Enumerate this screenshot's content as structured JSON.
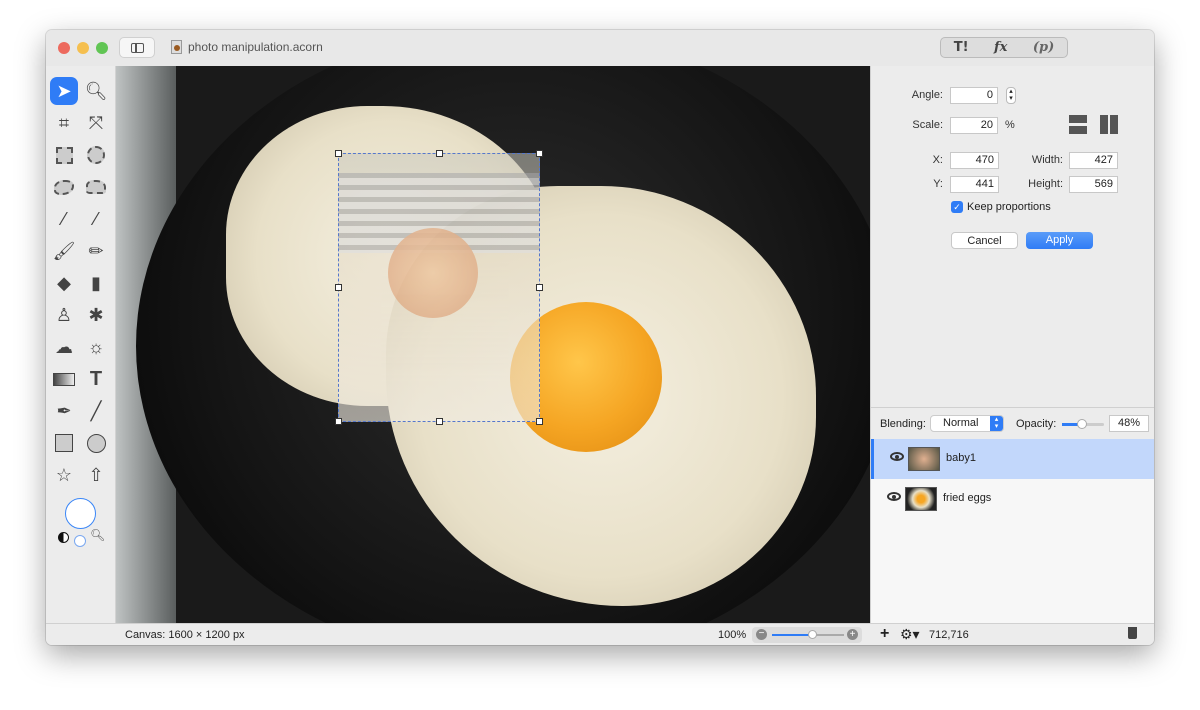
{
  "window": {
    "title": "photo manipulation.acorn",
    "traffic_lights": {
      "close": "#ed6a5e",
      "minimize": "#f5bf4f",
      "zoom": "#61c554"
    }
  },
  "toolbar_segments": [
    {
      "icon": "tools-icon",
      "label": "T!"
    },
    {
      "icon": "fx-icon",
      "label": "fx"
    },
    {
      "icon": "p-icon",
      "label": "(p)"
    }
  ],
  "tools": [
    "select-arrow",
    "zoom",
    "crop",
    "transform",
    "rect-select",
    "ellipse-select",
    "lasso",
    "polygon-lasso",
    "magic-wand",
    "color-select",
    "brush",
    "pencil",
    "paint-bucket",
    "eraser",
    "clone-stamp",
    "retouch",
    "smudge-cloud",
    "sun",
    "gradient",
    "text",
    "pen",
    "line",
    "rectangle",
    "circle",
    "star",
    "arrow"
  ],
  "transform": {
    "angle_label": "Angle:",
    "angle": "0",
    "scale_label": "Scale:",
    "scale": "20",
    "scale_unit": "%",
    "x_label": "X:",
    "x": "470",
    "y_label": "Y:",
    "y": "441",
    "width_label": "Width:",
    "width": "427",
    "height_label": "Height:",
    "height": "569",
    "keep_proportions_label": "Keep proportions",
    "keep_proportions": true,
    "cancel": "Cancel",
    "apply": "Apply"
  },
  "layers_bar": {
    "blending_label": "Blending:",
    "blending": "Normal",
    "opacity_label": "Opacity:",
    "opacity": "48%",
    "opacity_value": 0.48
  },
  "layers": [
    {
      "name": "baby1",
      "selected": true,
      "visible": true
    },
    {
      "name": "fried eggs",
      "selected": false,
      "visible": true
    }
  ],
  "status": {
    "canvas": "Canvas: 1600 × 1200 px",
    "zoom": "100%",
    "zoom_value": 0.55,
    "coords": "712,716"
  },
  "accent": "#2f7cf6"
}
